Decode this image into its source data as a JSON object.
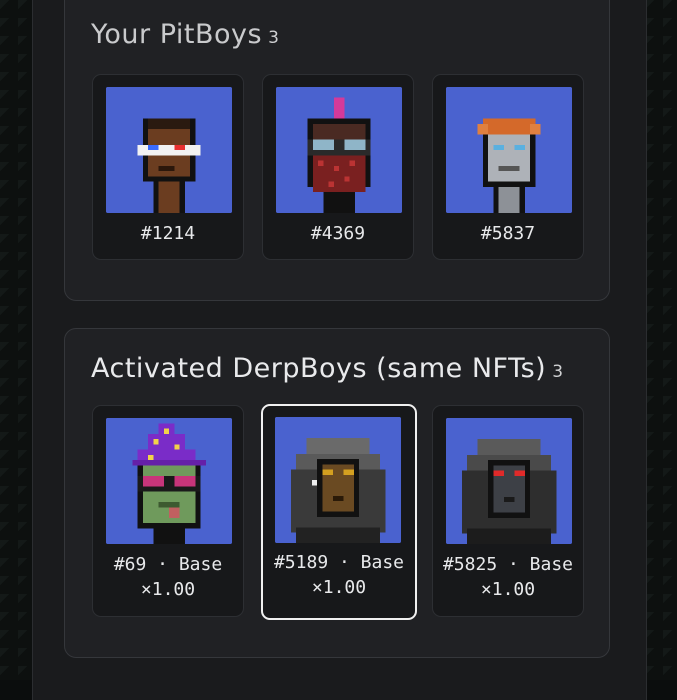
{
  "pitboys": {
    "title": "Your PitBoys",
    "count": "3",
    "items": [
      {
        "label": "#1214"
      },
      {
        "label": "#4369"
      },
      {
        "label": "#5837"
      }
    ]
  },
  "derpboys": {
    "title": "Activated DerpBoys (same NFTs)",
    "count": "3",
    "items": [
      {
        "label": "#69 · Base ×1.00"
      },
      {
        "label": "#5189 · Base ×1.00",
        "selected": true
      },
      {
        "label": "#5825 · Base ×1.00"
      }
    ]
  }
}
